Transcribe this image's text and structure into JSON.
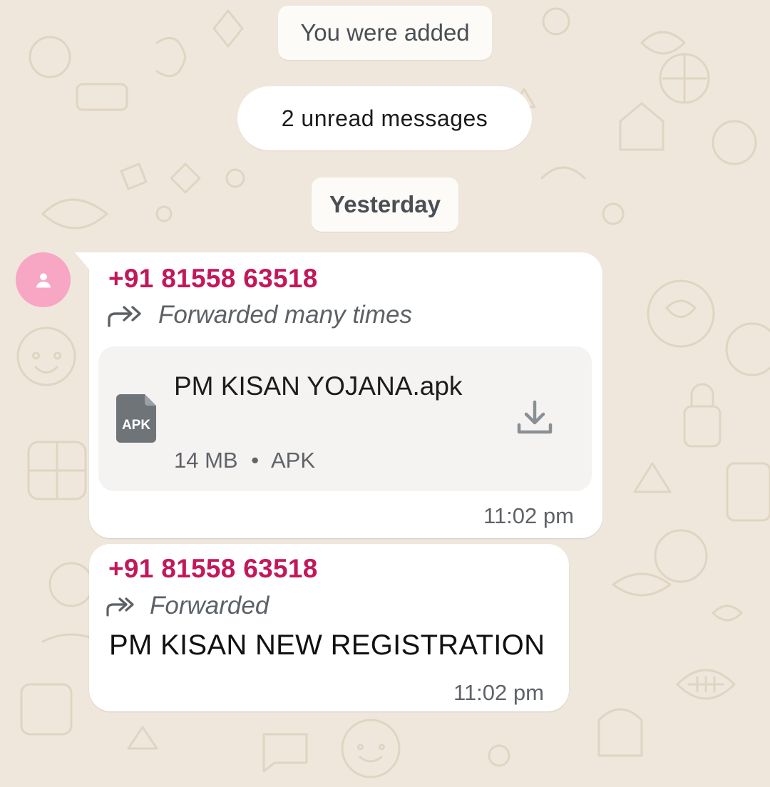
{
  "system": {
    "added": "You were added",
    "unread": "2 unread messages",
    "date": "Yesterday"
  },
  "messages": [
    {
      "sender": "+91 81558 63518",
      "forwarded": "Forwarded many times",
      "file": {
        "name": "PM KISAN YOJANA.apk",
        "badge": "APK",
        "size": "14 MB",
        "separator": "•",
        "type": "APK"
      },
      "time": "11:02 pm"
    },
    {
      "sender": "+91 81558 63518",
      "forwarded": "Forwarded",
      "text": "PM KISAN NEW REGISTRATION",
      "time": "11:02 pm"
    }
  ],
  "colors": {
    "sender": "#c2185b",
    "avatar": "#f7a6c3",
    "wallpaper": "#efe7dc"
  },
  "icons": [
    "avatar-person-icon",
    "forwarded-many-icon",
    "forwarded-icon",
    "apk-file-icon",
    "download-icon"
  ]
}
